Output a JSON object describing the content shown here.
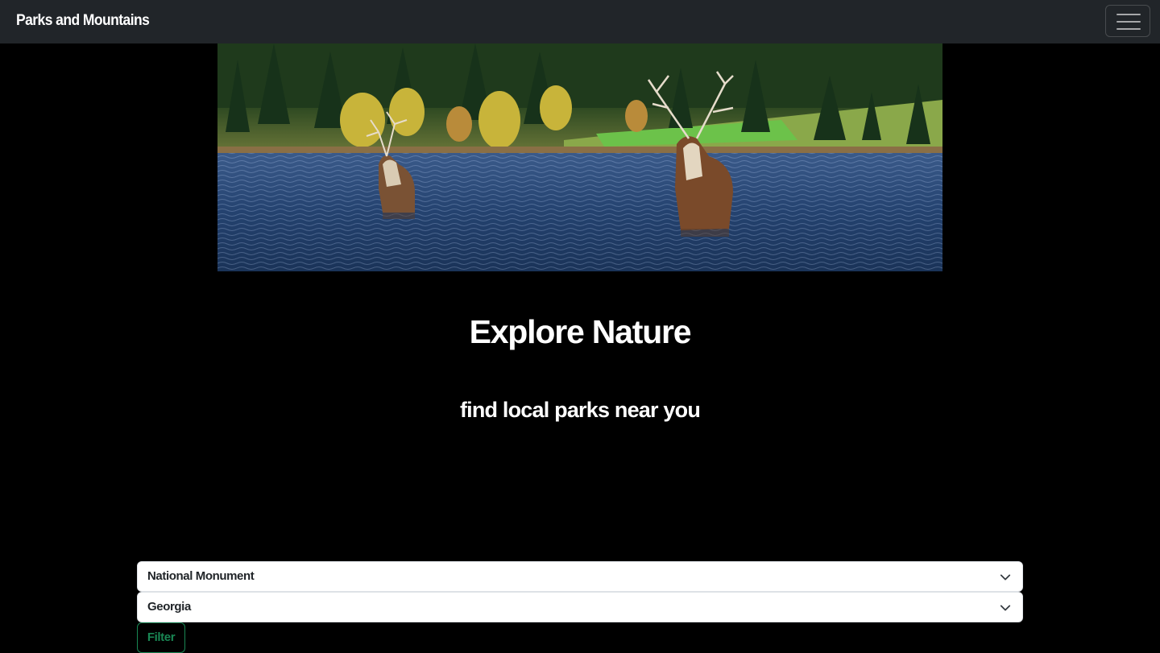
{
  "navbar": {
    "brand": "Parks and Mountains",
    "toggler_icon": "hamburger-menu-icon"
  },
  "hero": {
    "image": "elk-in-lake-photo"
  },
  "main": {
    "title": "Explore Nature",
    "subtitle": "find local parks near you"
  },
  "filters": {
    "designation_select": {
      "value": "National Monument"
    },
    "state_select": {
      "value": "Georgia"
    },
    "filter_button_label": "Filter"
  },
  "colors": {
    "navbar_bg": "#212529",
    "page_bg": "#000000",
    "filter_accent": "#198754"
  }
}
